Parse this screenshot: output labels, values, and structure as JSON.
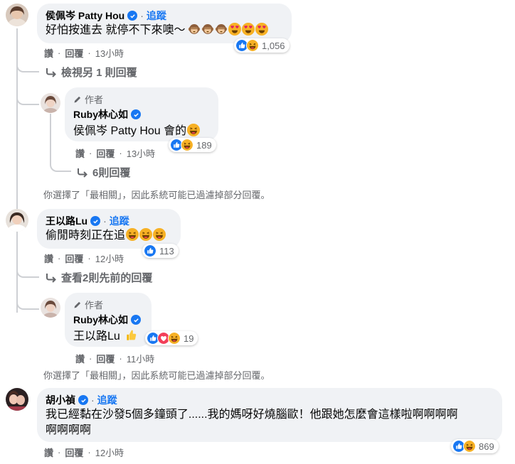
{
  "comments": [
    {
      "name": "侯佩岑 Patty Hou",
      "follow": "追蹤",
      "text": "好怕按進去 就停不下來噢～",
      "actions": {
        "like": "讚",
        "reply": "回覆",
        "time": "13小時"
      },
      "reaction_count": "1,056",
      "view_more": "檢視另 1 則回覆",
      "reply": {
        "author_tag": "作者",
        "name": "Ruby林心如",
        "text": "侯佩岑 Patty Hou 會的",
        "actions": {
          "like": "讚",
          "reply": "回覆",
          "time": "13小時"
        },
        "reaction_count": "189",
        "more_replies": "6則回覆"
      }
    },
    {
      "name": "王以路Lu",
      "follow": "追蹤",
      "text": "偷閒時刻正在追",
      "actions": {
        "like": "讚",
        "reply": "回覆",
        "time": "12小時"
      },
      "reaction_count": "113",
      "view_more": "查看2則先前的回覆",
      "reply": {
        "author_tag": "作者",
        "name": "Ruby林心如",
        "text": "王以路Lu",
        "actions": {
          "like": "讚",
          "reply": "回覆",
          "time": "11小時"
        },
        "reaction_count": "19"
      }
    },
    {
      "name": "胡小禎",
      "follow": "追蹤",
      "text_line1": "我已經黏在沙發5個多鐘頭了......我的媽呀好燒腦歐！他跟她怎麼會這樣啦啊啊啊啊",
      "text_line2": "啊啊啊啊",
      "actions": {
        "like": "讚",
        "reply": "回覆",
        "time": "12小時"
      },
      "reaction_count": "869"
    }
  ],
  "filter_note": "你選擇了「最相關」，因此系統可能已過濾掉部分回覆。",
  "colors": {
    "accent": "#1877f2",
    "bubble": "#f0f2f5",
    "muted": "#65676b",
    "haha": "#f7b125",
    "love": "#f33e58"
  }
}
